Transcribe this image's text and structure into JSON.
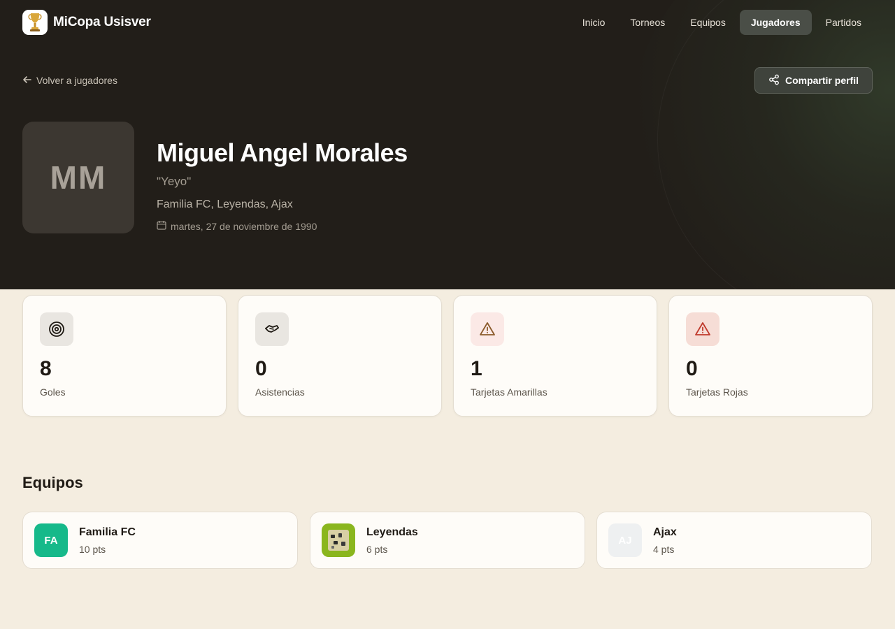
{
  "app": {
    "name": "MiCopa Usisver",
    "logo_icon": "trophy-icon"
  },
  "nav": {
    "items": [
      {
        "label": "Inicio",
        "active": false
      },
      {
        "label": "Torneos",
        "active": false
      },
      {
        "label": "Equipos",
        "active": false
      },
      {
        "label": "Jugadores",
        "active": true
      },
      {
        "label": "Partidos",
        "active": false
      }
    ]
  },
  "header": {
    "back_label": "Volver a jugadores",
    "share_label": "Compartir perfil"
  },
  "player": {
    "initials": "MM",
    "name": "Miguel Angel Morales",
    "nickname": "\"Yeyo\"",
    "teams_line": "Familia FC, Leyendas, Ajax",
    "birth_date": "martes, 27 de noviembre de 1990"
  },
  "stats": [
    {
      "value": "8",
      "label": "Goles",
      "icon": "target-icon",
      "icon_bg": "#e9e6e1",
      "icon_color": "#1f1a14"
    },
    {
      "value": "0",
      "label": "Asistencias",
      "icon": "handshake-icon",
      "icon_bg": "#e9e6e1",
      "icon_color": "#1f1a14"
    },
    {
      "value": "1",
      "label": "Tarjetas Amarillas",
      "icon": "warning-icon",
      "icon_bg": "#fbe9e6",
      "icon_color": "#8a5a2a"
    },
    {
      "value": "0",
      "label": "Tarjetas Rojas",
      "icon": "warning-icon",
      "icon_bg": "#f6ddd6",
      "icon_color": "#c0392b"
    }
  ],
  "teams_section": {
    "title": "Equipos",
    "teams": [
      {
        "badge": "FA",
        "name": "Familia FC",
        "points": "10 pts",
        "badge_bg": "#16b98a"
      },
      {
        "badge": "",
        "name": "Leyendas",
        "points": "6 pts",
        "badge_bg": "#8ab61e"
      },
      {
        "badge": "AJ",
        "name": "Ajax",
        "points": "4 pts",
        "badge_bg": "#eef0f1"
      }
    ]
  },
  "colors": {
    "hero_bg": "#221e19",
    "page_bg": "#f4ede0",
    "accent_active": "#4a4e47"
  }
}
